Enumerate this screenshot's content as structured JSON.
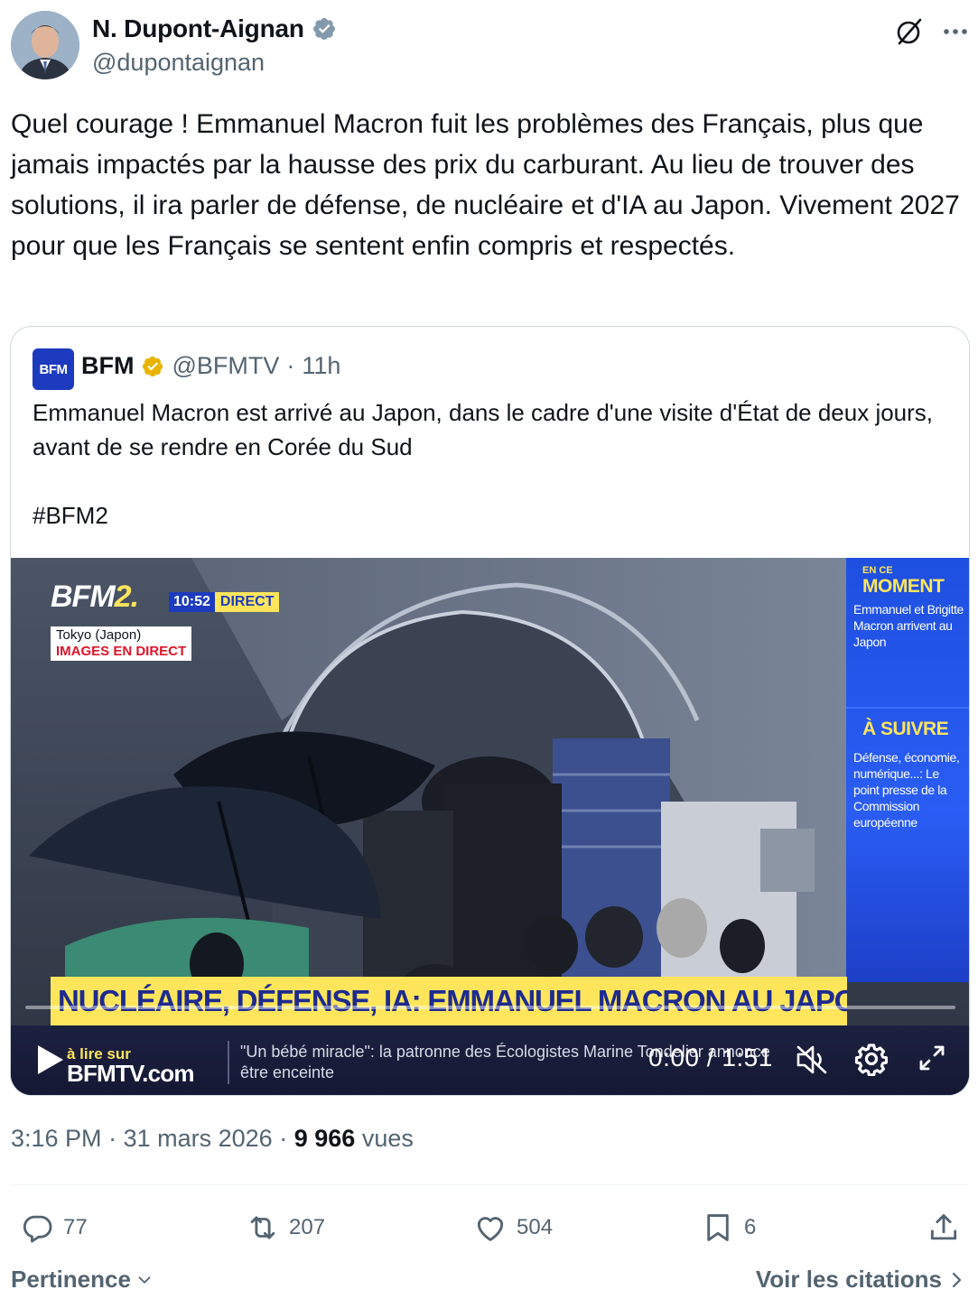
{
  "author": {
    "name": "N. Dupont-Aignan",
    "handle": "@dupontaignan",
    "verified_color": "#829aab"
  },
  "tweet": {
    "text": "Quel courage ! Emmanuel Macron fuit les problèmes des Français, plus que jamais impactés par la hausse des prix du carburant. Au lieu de trouver des solutions, il ira parler de défense, de nucléaire et d'IA au Japon. Vivement 2027 pour que les Français se sentent enfin compris et respectés."
  },
  "quote": {
    "logo_text": "BFM",
    "name": "BFM",
    "handle": "@BFMTV",
    "dot": "·",
    "time": "11h",
    "verified_color": "#e8b400",
    "text": "Emmanuel Macron est arrivé au Japon, dans le cadre d'une visite d'État de deux jours, avant de se rendre en Corée du Sud",
    "hashtag": "#BFM2",
    "video": {
      "channel_logo_a": "BFM",
      "channel_logo_b": "2.",
      "clock": "10:52",
      "live_badge": "DIRECT",
      "location": "Tokyo (Japon)",
      "live_label": "IMAGES EN DIRECT",
      "panel": {
        "small": "EN CE",
        "moment": "MOMENT",
        "moment_text": "Emmanuel et Brigitte Macron arrivent au Japon",
        "next": "À SUIVRE",
        "next_text": "Défense, économie, numérique...: Le point presse de la Commission européenne"
      },
      "headline": "NUCLÉAIRE, DÉFENSE, IA: EMMANUEL MACRON AU JAPON",
      "promo_top": "à lire sur",
      "promo_bottom": "BFMTV.com",
      "ticker": "\"Un bébé miracle\": la patronne des Écologistes Marine Tondelier annonce être enceinte",
      "time_readout": "0:00 / 1:51",
      "progress": 0
    }
  },
  "meta": {
    "time": "3:16 PM",
    "dot1": "·",
    "date": "31 mars 2026",
    "dot2": "·",
    "views_count": "9 966",
    "views_label": "vues"
  },
  "actions": {
    "replies": "77",
    "reposts": "207",
    "likes": "504",
    "bookmarks": "6"
  },
  "footer": {
    "sort_label": "Pertinence",
    "quotes_label": "Voir les citations"
  }
}
